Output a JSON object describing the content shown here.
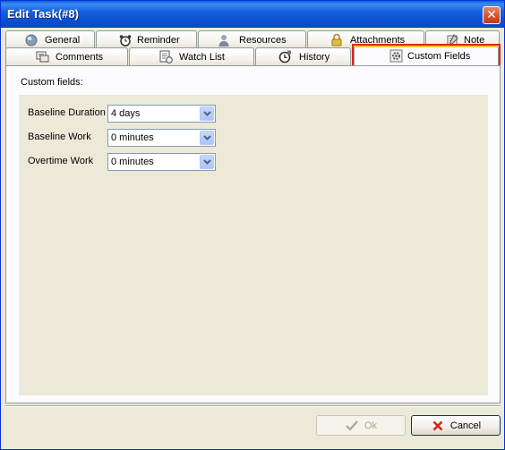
{
  "window": {
    "title": "Edit Task(#8)",
    "close_glyph": "✕"
  },
  "tabs_row1": [
    {
      "label": "General",
      "icon": "globe-icon"
    },
    {
      "label": "Reminder",
      "icon": "alarm-clock-icon"
    },
    {
      "label": "Resources",
      "icon": "user-icon"
    },
    {
      "label": "Attachments",
      "icon": "lock-icon"
    },
    {
      "label": "Note",
      "icon": "note-icon"
    }
  ],
  "tabs_row2": [
    {
      "label": "Comments",
      "icon": "comments-icon"
    },
    {
      "label": "Watch List",
      "icon": "watch-list-icon"
    },
    {
      "label": "History",
      "icon": "history-icon"
    },
    {
      "label": "Custom Fields",
      "icon": "gear-icon",
      "active": true
    }
  ],
  "panel": {
    "section_label": "Custom fields:",
    "fields": [
      {
        "label": "Baseline Duration",
        "value": "4 days"
      },
      {
        "label": "Baseline Work",
        "value": "0 minutes"
      },
      {
        "label": "Overtime Work",
        "value": "0 minutes"
      }
    ]
  },
  "buttons": {
    "ok_label": "Ok",
    "cancel_label": "Cancel"
  },
  "colors": {
    "title_bar": "#0a4fcf",
    "highlight": "#e0231f",
    "active_tab_accent": "#ffc83c"
  }
}
